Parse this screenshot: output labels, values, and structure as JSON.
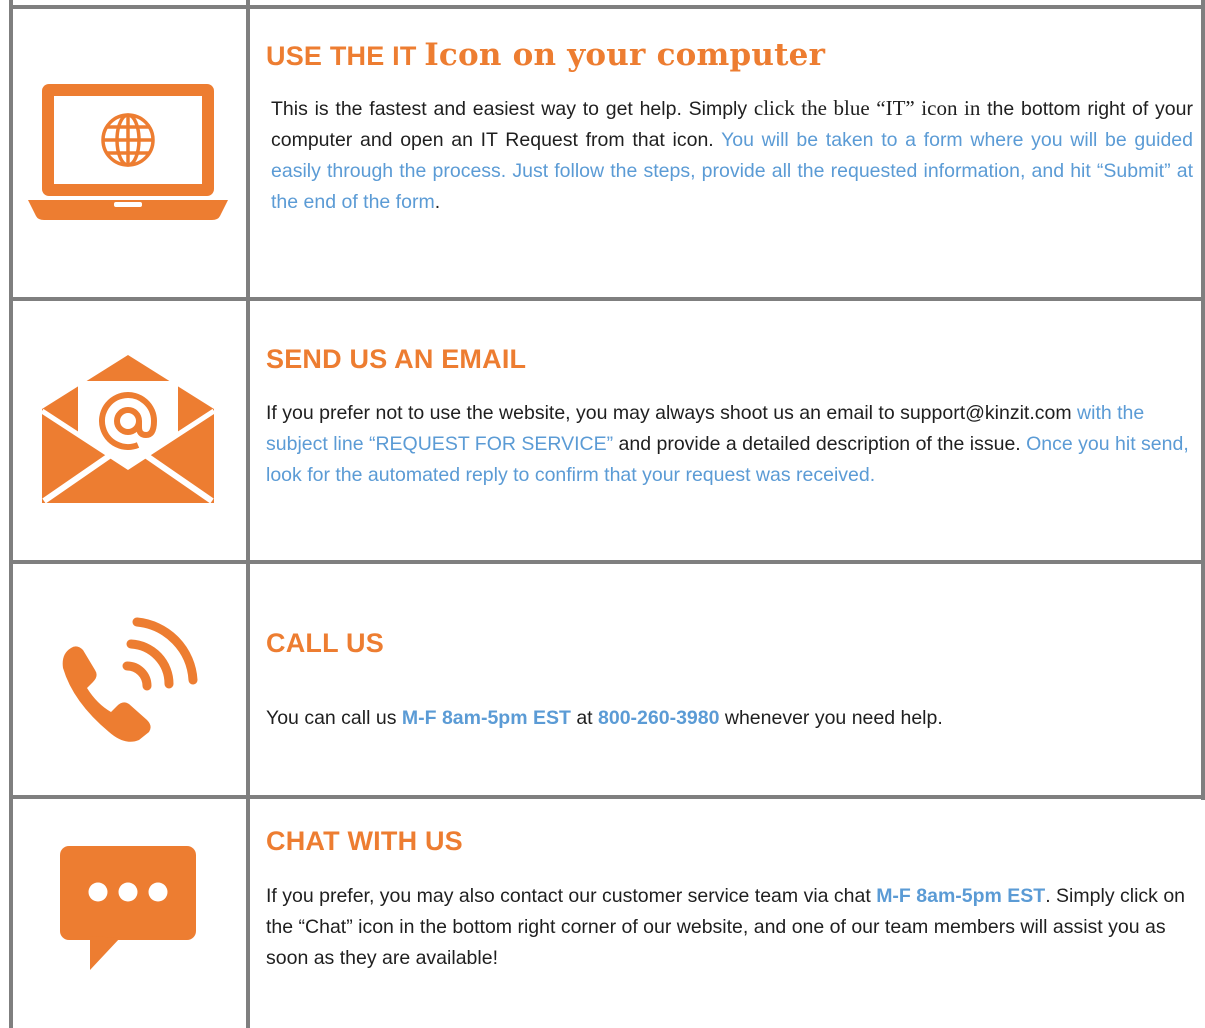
{
  "sections": [
    {
      "title_caps": "USE THE IT",
      "title_serif": "Icon on your computer",
      "p1_a": "This is the fastest and easiest way to get help. Simply ",
      "p1_b": "click the blue “IT” icon in",
      "p1_c": " the bottom right of your computer and open an IT Request from that icon. ",
      "p1_d": "You will be taken to a form where you will be guided easily through the process. Just follow the steps, provide all the requested information, and hit “Submit” at the end of the form",
      "p1_e": ".",
      "icon": "laptop-globe-icon"
    },
    {
      "title": "SEND US AN EMAIL",
      "p_a": "If you prefer not to use the website, you may always shoot us an email to support@kinzit.com",
      "p_b": " with the subject line “REQUEST FOR SERVICE”",
      "p_c": " and provide a detailed description of the issue. ",
      "p_d": "Once you hit send, look for the automated reply to confirm that your request was received.",
      "icon": "open-envelope-at-icon"
    },
    {
      "title": "CALL US",
      "p_a": "You can call us ",
      "hours": "M-F 8am-5pm EST",
      "p_b": " at ",
      "phone": "800-260-3980",
      "p_c": " whenever you need help.",
      "icon": "phone-ringing-icon"
    },
    {
      "title": "CHAT WITH US",
      "p_a": "If you prefer, you may also contact our customer service team via chat  ",
      "hours": "M-F 8am-5pm EST",
      "p_b": ". Simply click on the “Chat” icon in the bottom right corner of our website, and one of our team members will assist you as soon as they are available!",
      "icon": "chat-bubble-icon"
    }
  ],
  "colors": {
    "accent": "#ed7d31",
    "link": "#5b9bd5",
    "border": "#7f7f7f"
  }
}
